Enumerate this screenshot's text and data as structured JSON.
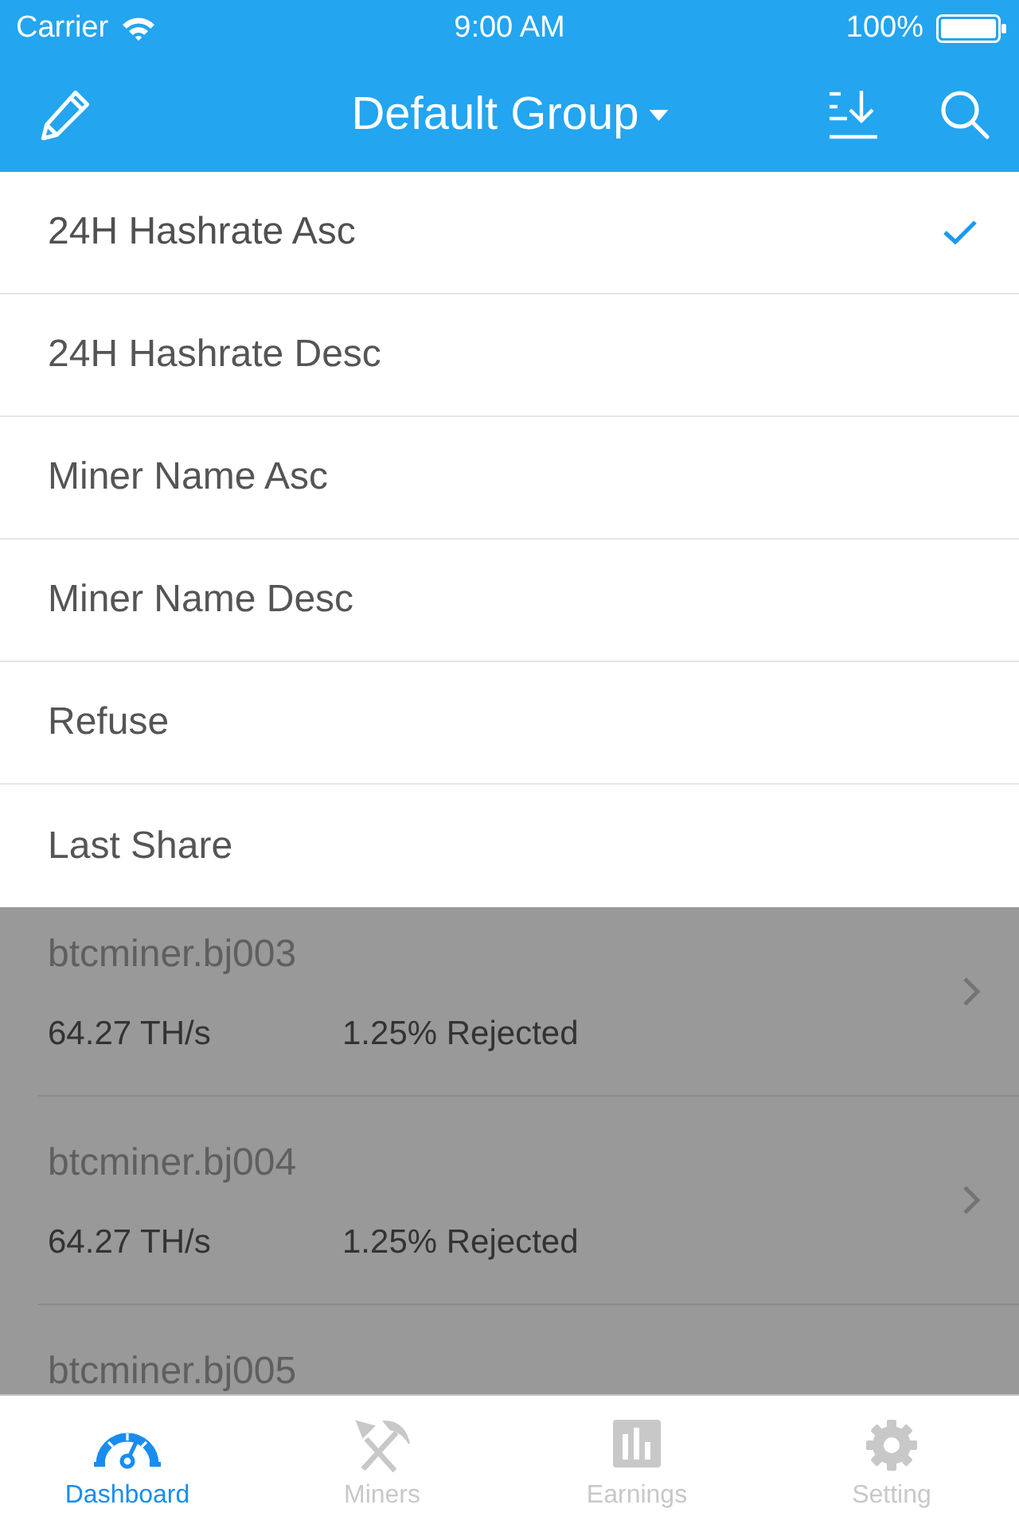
{
  "status_bar": {
    "carrier": "Carrier",
    "time": "9:00 AM",
    "battery": "100%"
  },
  "nav_bar": {
    "title": "Default Group"
  },
  "sort_menu": [
    {
      "label": "24H Hashrate Asc",
      "selected": true
    },
    {
      "label": "24H Hashrate Desc",
      "selected": false
    },
    {
      "label": "Miner Name Asc",
      "selected": false
    },
    {
      "label": "Miner Name Desc",
      "selected": false
    },
    {
      "label": "Refuse",
      "selected": false
    },
    {
      "label": "Last Share",
      "selected": false
    }
  ],
  "miners": [
    {
      "name": "btcminer.bj003",
      "hashrate": "64.27 TH/s",
      "rejected": "1.25% Rejected"
    },
    {
      "name": "btcminer.bj004",
      "hashrate": "64.27 TH/s",
      "rejected": "1.25% Rejected"
    },
    {
      "name": "btcminer.bj005"
    }
  ],
  "tab_bar": [
    {
      "kind": "dashboard",
      "label": "Dashboard",
      "selected": true
    },
    {
      "kind": "miners",
      "label": "Miners",
      "selected": false
    },
    {
      "kind": "earnings",
      "label": "Earnings",
      "selected": false
    },
    {
      "kind": "setting",
      "label": "Setting",
      "selected": false
    }
  ]
}
